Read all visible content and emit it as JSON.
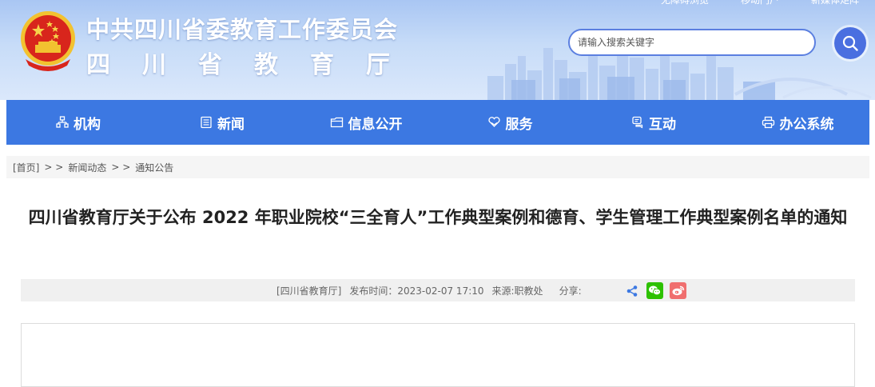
{
  "header": {
    "org_name": "中共四川省委教育工作委员会",
    "dept_name": "四川省教育厅",
    "top_links": [
      "无障碍浏览",
      "移动门户",
      "新媒体矩阵"
    ],
    "search_placeholder": "请输入搜索关键字",
    "search_icon": "search-icon",
    "emblem": "national-emblem"
  },
  "nav": {
    "items": [
      {
        "label": "机构",
        "icon": "org-chart-icon"
      },
      {
        "label": "新闻",
        "icon": "newspaper-icon"
      },
      {
        "label": "信息公开",
        "icon": "folder-icon"
      },
      {
        "label": "服务",
        "icon": "heart-hand-icon"
      },
      {
        "label": "互动",
        "icon": "chat-icon"
      },
      {
        "label": "办公系统",
        "icon": "printer-icon"
      }
    ],
    "color": "#3c78e2"
  },
  "breadcrumb": {
    "home": "[首页]",
    "sep1": "> >",
    "level1": "新闻动态",
    "sep2": "> >",
    "level2": "通知公告"
  },
  "article": {
    "title": "四川省教育厅关于公布 2022 年职业院校“三全育人”工作典型案例和德育、学生管理工作典型案例名单的通知",
    "source_tag": "[四川省教育厅]",
    "publish_time": "发布时间：2023-02-07 17:10",
    "origin": "来源:职教处",
    "share_label": "分享:",
    "share_icons": [
      "share-icon",
      "wechat-icon",
      "weibo-icon"
    ]
  }
}
